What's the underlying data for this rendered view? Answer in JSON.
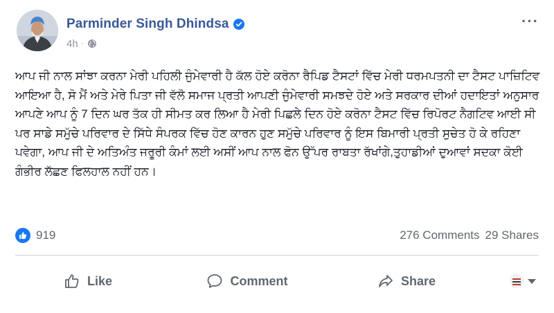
{
  "post": {
    "author": "Parminder Singh Dhindsa",
    "time": "4h",
    "time_separator": "·",
    "more_label": "···",
    "text": "ਆਪ ਜੀ ਨਾਲ ਸਾਂਝਾ ਕਰਨਾ ਮੇਰੀ ਪਹਿਲੀ ਜੁੰਮੇਵਾਰੀ ਹੈ ਕੱਲ ਹੋਏ ਕਰੋਨਾ ਰੈਪਿਡ ਟੈਸਟਾਂ ਵਿੱਚ ਮੇਰੀ ਧਰਮਪਤਨੀ ਦਾ ਟੈਸਟ ਪਾਜ਼ਿਟਿਵ ਆਇਆ ਹੈ, ਸੋ ਮੈਂ ਅਤੇ ਮੇਰੇ ਪਿਤਾ ਜੀ ਵੱਲੋ ਸਮਾਜ ਪ੍ਰਤੀ ਆਪਣੀ ਜੁੰਮੇਵਾਰੀ ਸਮਝਦੇ ਹੋਏ ਅਤੇ ਸਰਕਾਰ ਦੀਆਂ ਹਦਾਇਤਾਂ ਅਨੁਸਾਰ ਆਪਣੇ ਆਪ ਨੂੰ 7 ਦਿਨ ਘਰ ਤੱਕ ਹੀ ਸੀਮਤ ਕਰ ਲਿਆ ਹੈ ਮੇਰੀ ਪਿਛਲੇ ਦਿਨ ਹੋਏ ਕਰੋਨਾ ਟੈਸਟ ਵਿੱਚ ਰਿਪੋਰਟ ਨੈਗਟਿਵ ਆਈ ਸੀ ਪਰ ਸਾਡੇ ਸਮੁੱਚੇ ਪਰਿਵਾਰ ਦੇ ਸਿੱਧੇ ਸੰਪਰਕ ਵਿੱਚ ਹੋਣ ਕਾਰਨ ਹੁਣ ਸਮੁੱਚੇ ਪਰਿਵਾਰ ਨੂੰ ਇਸ ਬਿਮਾਰੀ ਪ੍ਰਤੀ ਸੁਚੇਤ ਹੋ ਕੇ ਰਹਿਣਾ ਪਵੇਗਾ, ਆਪ ਜੀ ਦੇ ਅਤਿਅੰਤ ਜਰੂਰੀ ਕੰਮਾਂ ਲਈ ਅਸੀਂ ਆਪ ਨਾਲ ਫੋਨ ਉੱਪਰ ਰਾਬਤਾ ਰੱਖਾਂਗੇ,ਤੁਹਾਡੀਆਂ ਦੁਆਵਾਂ ਸਦਕਾ ਕੋਈ ਗੰਭੀਰ ਲੱਛਣ ਫਿਲਹਾਲ ਨਹੀਂ ਹਨ।"
  },
  "stats": {
    "likes": "919",
    "comments": "276 Comments",
    "shares": "29 Shares"
  },
  "actions": {
    "like": "Like",
    "comment": "Comment",
    "share": "Share"
  },
  "colors": {
    "name": "#385898",
    "accent": "#1877f2",
    "muted": "#606770"
  },
  "icons": [
    "verified-badge-icon",
    "globe-icon",
    "more-options-icon",
    "like-reaction-icon",
    "thumbs-up-icon",
    "comment-icon",
    "share-icon",
    "caret-down-icon"
  ]
}
